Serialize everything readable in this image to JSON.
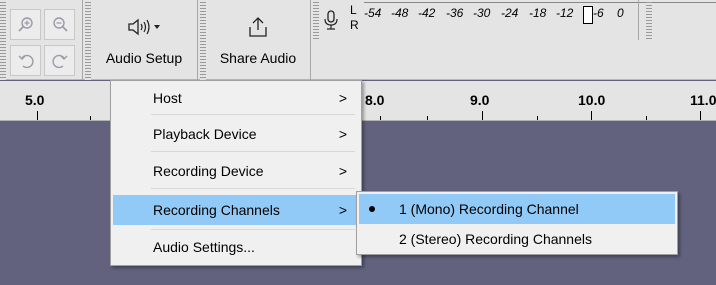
{
  "toolbar": {
    "zoom_in_icon": "zoom-in-icon",
    "zoom_out_icon": "zoom-out-icon",
    "undo_icon": "undo-icon",
    "redo_icon": "redo-icon",
    "audio_setup_label": "Audio Setup",
    "share_audio_label": "Share Audio"
  },
  "meter": {
    "channel_l": "L",
    "channel_r": "R",
    "ticks": [
      "-54",
      "-48",
      "-42",
      "-36",
      "-30",
      "-24",
      "-18",
      "-12",
      "-6",
      "0"
    ]
  },
  "ruler": {
    "labels": [
      "5.0",
      "8.0",
      "9.0",
      "10.0",
      "11.0"
    ]
  },
  "audio_setup_menu": {
    "items": [
      {
        "label": "Host",
        "arrow": ">"
      },
      {
        "label": "Playback Device",
        "arrow": ">"
      },
      {
        "label": "Recording Device",
        "arrow": ">"
      },
      {
        "label": "Recording Channels",
        "arrow": ">"
      },
      {
        "label": "Audio Settings...",
        "arrow": ""
      }
    ]
  },
  "channels_submenu": {
    "items": [
      {
        "label": "1 (Mono) Recording Channel",
        "selected": true
      },
      {
        "label": "2 (Stereo) Recording Channels",
        "selected": false
      }
    ]
  },
  "colors": {
    "track_background": "#62627f",
    "highlight": "#91c9f7",
    "toolbar": "#e4e4e4"
  }
}
